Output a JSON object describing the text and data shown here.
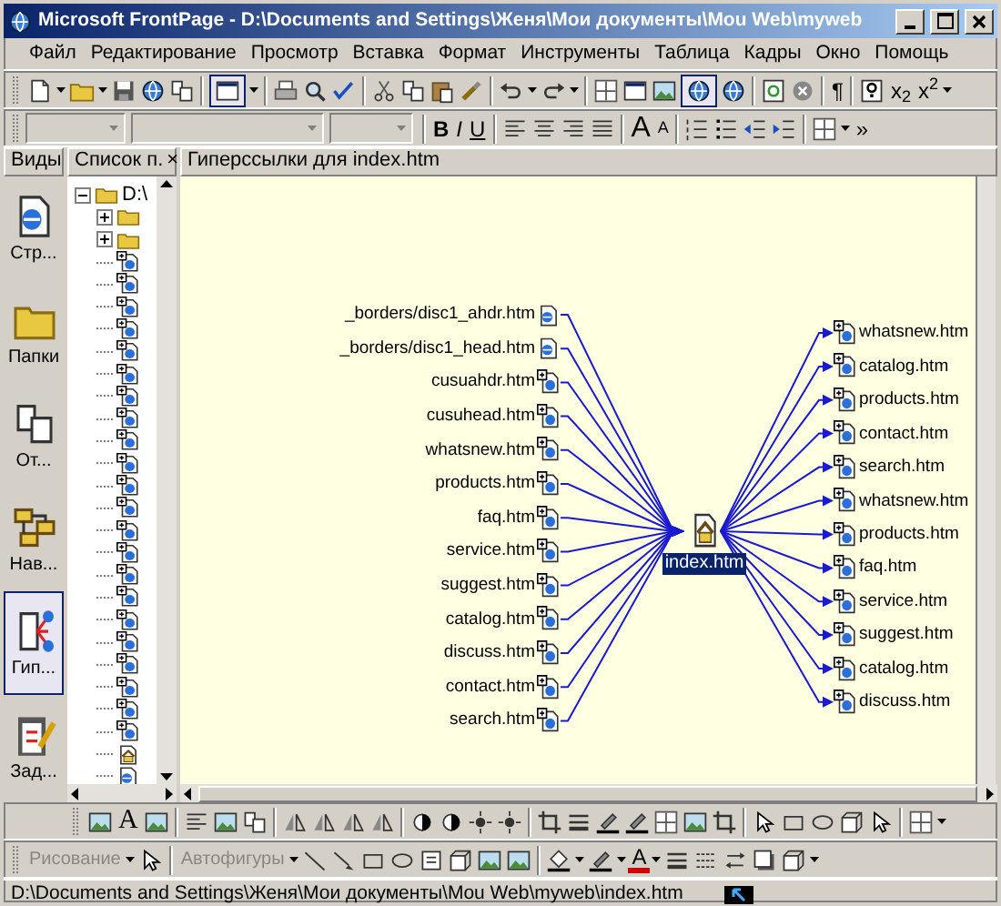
{
  "window": {
    "title": "Microsoft FrontPage - D:\\Documents and Settings\\Женя\\Мои документы\\Mou Web\\myweb"
  },
  "menu": [
    "Файл",
    "Редактирование",
    "Просмотр",
    "Вставка",
    "Формат",
    "Инструменты",
    "Таблица",
    "Кадры",
    "Окно",
    "Помощь"
  ],
  "standard_toolbar": {
    "view_button_pressed": true,
    "web_button_pressed": true,
    "texts": [
      "¶",
      "x$_{2}$",
      "x$^{2}$"
    ]
  },
  "formatting_toolbar": {
    "texts": [
      "B",
      "I",
      "U",
      "A",
      "A",
      "»"
    ]
  },
  "panes": [
    {
      "title": "Виды"
    },
    {
      "title": "Список п.",
      "close": "×"
    },
    {
      "title": "Гиперссылки для index.htm"
    }
  ],
  "views": [
    {
      "label": "Стр...",
      "selected": false
    },
    {
      "label": "Папки",
      "selected": false
    },
    {
      "label": "От...",
      "selected": false
    },
    {
      "label": "Нав...",
      "selected": false
    },
    {
      "label": "Гип...",
      "selected": true
    },
    {
      "label": "Зад...",
      "selected": false
    }
  ],
  "folder_tree": {
    "label": "D:\\",
    "expanded": true,
    "children": [
      {
        "kind": "folder",
        "expanded": false
      },
      {
        "kind": "folder",
        "expanded": false
      },
      {
        "kind": "page"
      },
      {
        "kind": "page"
      },
      {
        "kind": "page"
      },
      {
        "kind": "page"
      },
      {
        "kind": "page"
      },
      {
        "kind": "page"
      },
      {
        "kind": "page"
      },
      {
        "kind": "page"
      },
      {
        "kind": "page"
      },
      {
        "kind": "page"
      },
      {
        "kind": "page"
      },
      {
        "kind": "page"
      },
      {
        "kind": "page"
      },
      {
        "kind": "page"
      },
      {
        "kind": "page"
      },
      {
        "kind": "page"
      },
      {
        "kind": "page"
      },
      {
        "kind": "page"
      },
      {
        "kind": "page"
      },
      {
        "kind": "page"
      },
      {
        "kind": "page"
      },
      {
        "kind": "page"
      },
      {
        "kind": "home"
      },
      {
        "kind": "web"
      }
    ]
  },
  "hyperlinks": {
    "incoming": [
      {
        "label": "_borders/disc1_ahdr.htm",
        "kind": "web"
      },
      {
        "label": "_borders/disc1_head.htm",
        "kind": "web"
      },
      {
        "label": "cusuahdr.htm",
        "kind": "page"
      },
      {
        "label": "cusuhead.htm",
        "kind": "page"
      },
      {
        "label": "whatsnew.htm",
        "kind": "page"
      },
      {
        "label": "products.htm",
        "kind": "page"
      },
      {
        "label": "faq.htm",
        "kind": "page"
      },
      {
        "label": "service.htm",
        "kind": "page"
      },
      {
        "label": "suggest.htm",
        "kind": "page"
      },
      {
        "label": "catalog.htm",
        "kind": "page"
      },
      {
        "label": "discuss.htm",
        "kind": "page"
      },
      {
        "label": "contact.htm",
        "kind": "page"
      },
      {
        "label": "search.htm",
        "kind": "page"
      }
    ],
    "center": {
      "label": "index.htm",
      "selected": true
    },
    "outgoing": [
      {
        "label": "whatsnew.htm",
        "kind": "page"
      },
      {
        "label": "catalog.htm",
        "kind": "page"
      },
      {
        "label": "products.htm",
        "kind": "page"
      },
      {
        "label": "contact.htm",
        "kind": "page"
      },
      {
        "label": "search.htm",
        "kind": "page"
      },
      {
        "label": "whatsnew.htm",
        "kind": "page"
      },
      {
        "label": "products.htm",
        "kind": "page"
      },
      {
        "label": "faq.htm",
        "kind": "page"
      },
      {
        "label": "service.htm",
        "kind": "page"
      },
      {
        "label": "suggest.htm",
        "kind": "page"
      },
      {
        "label": "catalog.htm",
        "kind": "page"
      },
      {
        "label": "discuss.htm",
        "kind": "page"
      }
    ]
  },
  "pictures_toolbar": {
    "texts": [
      "A"
    ]
  },
  "drawing_toolbar": {
    "menus": [
      {
        "label": "Рисование",
        "disabled": true
      },
      {
        "label": "Автофигуры",
        "disabled": true
      }
    ],
    "texts": [
      "A"
    ]
  },
  "status_bar": {
    "path": "D:\\Documents and Settings\\Женя\\Мои документы\\Mou Web\\myweb\\index.htm"
  }
}
